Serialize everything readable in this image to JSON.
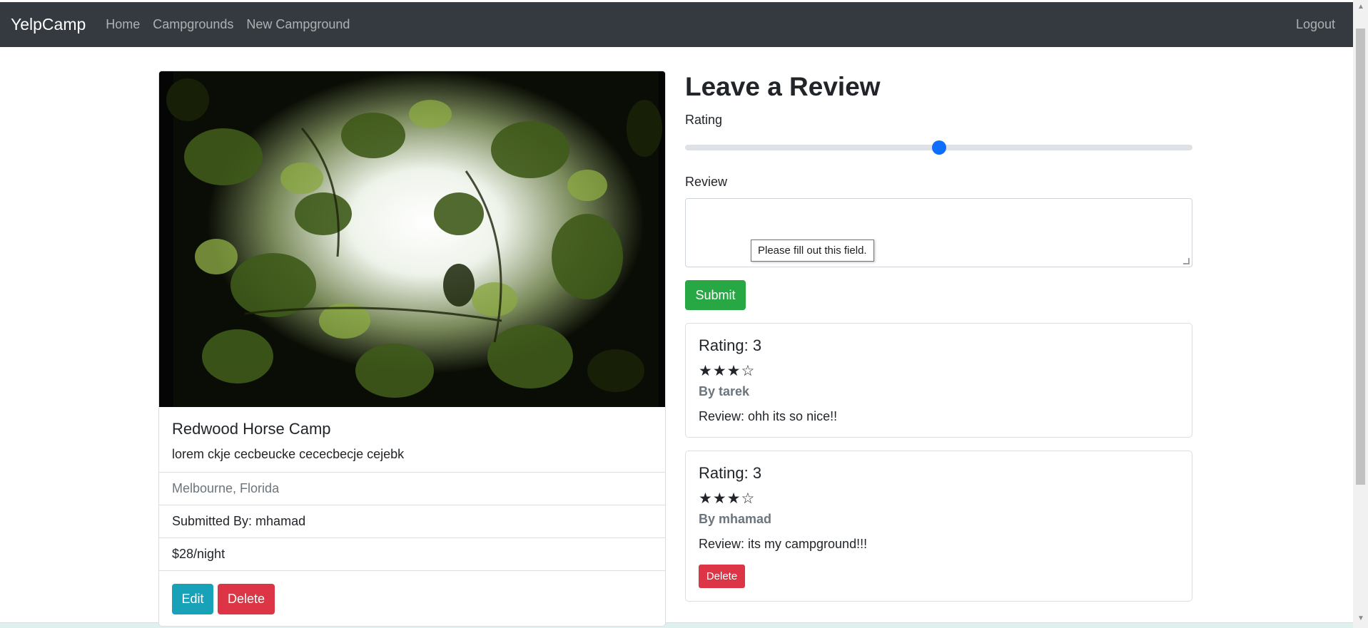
{
  "navbar": {
    "brand": "YelpCamp",
    "links": [
      "Home",
      "Campgrounds",
      "New Campground"
    ],
    "logout": "Logout"
  },
  "campground": {
    "title": "Redwood Horse Camp",
    "description": "lorem ckje cecbeucke cececbecje cejebk",
    "location": "Melbourne, Florida",
    "submitted_by": "Submitted By: mhamad",
    "price": "$28/night",
    "edit_label": "Edit",
    "delete_label": "Delete"
  },
  "review_form": {
    "title": "Leave a Review",
    "rating_label": "Rating",
    "rating_fraction": 0.5,
    "review_label": "Review",
    "review_value": "",
    "validation_tooltip": "Please fill out this field.",
    "submit_label": "Submit"
  },
  "reviews": [
    {
      "rating": "Rating: 3",
      "stars": "★★★☆",
      "author": "By tarek",
      "text": "Review: ohh its so nice!!"
    },
    {
      "rating": "Rating: 3",
      "stars": "★★★☆",
      "author": "By mhamad",
      "text": "Review: its my campground!!!",
      "delete_label": "Delete"
    }
  ],
  "colors": {
    "navbar_bg": "#343a40",
    "primary": "#0d6efd",
    "success": "#28a745",
    "danger": "#dc3545",
    "info": "#17a2b8",
    "muted": "#6c757d"
  }
}
